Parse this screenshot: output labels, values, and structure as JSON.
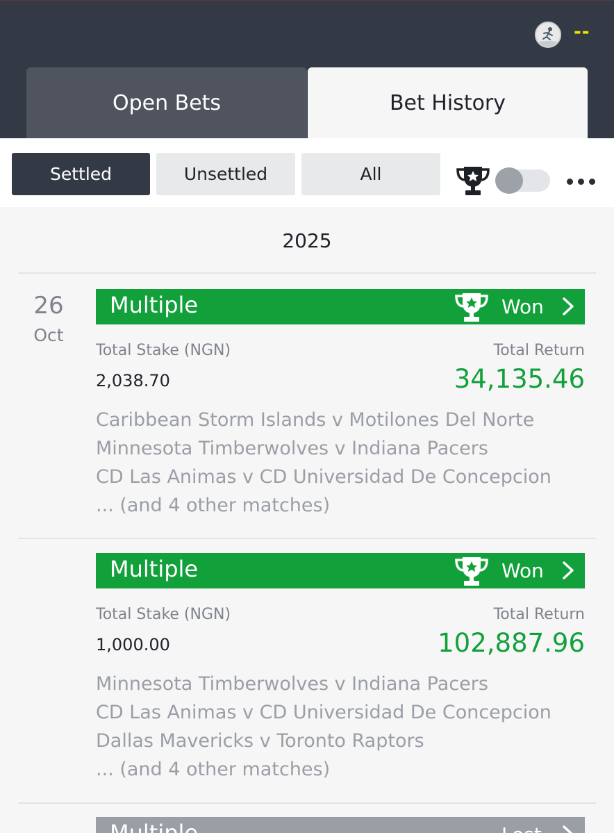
{
  "header": {
    "balance": "--",
    "tabs": [
      {
        "label": "Open Bets",
        "active": false
      },
      {
        "label": "Bet History",
        "active": true
      }
    ]
  },
  "filters": {
    "segments": [
      "Settled",
      "Unsettled",
      "All"
    ],
    "selected": "Settled",
    "won_only_toggle": false,
    "icons": [
      "trophy-icon",
      "more-icon"
    ]
  },
  "year": "2025",
  "date": {
    "day": "26",
    "month": "Oct"
  },
  "labels": {
    "stake": "Total Stake (NGN)",
    "return": "Total Return"
  },
  "bets": [
    {
      "type": "Multiple",
      "result": "Won",
      "stake": "2,038.70",
      "return": "34,135.46",
      "matches": [
        "Caribbean Storm Islands v Motilones Del Norte",
        "Minnesota Timberwolves v Indiana Pacers",
        "CD Las Animas v CD Universidad De Concepcion",
        "... (and 4 other matches)"
      ]
    },
    {
      "type": "Multiple",
      "result": "Won",
      "stake": "1,000.00",
      "return": "102,887.96",
      "matches": [
        "Minnesota Timberwolves v Indiana Pacers",
        "CD Las Animas v CD Universidad De Concepcion",
        "Dallas Mavericks v Toronto Raptors",
        "... (and 4 other matches)"
      ]
    },
    {
      "type": "Multiple",
      "result": "Lost"
    }
  ],
  "colors": {
    "won": "#11a03a",
    "lost": "#9a9ea5",
    "header_bg": "#343a45",
    "balance": "#f2e200"
  }
}
